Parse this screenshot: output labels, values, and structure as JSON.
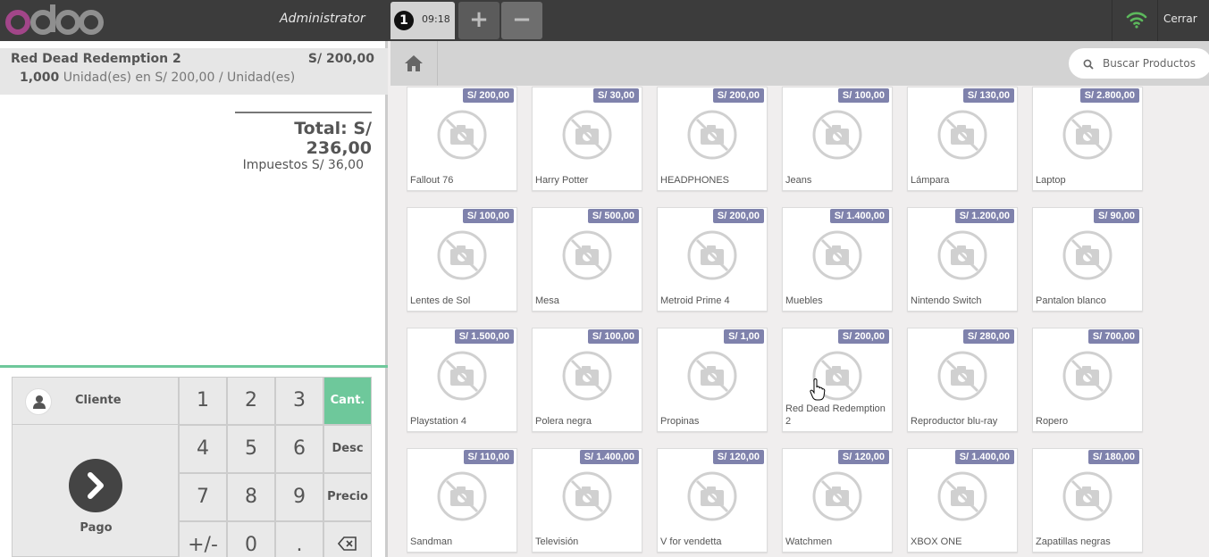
{
  "header": {
    "logo": "odoo",
    "user": "Administrator",
    "order_tab": {
      "number": "1",
      "time": "09:18"
    },
    "add_order": "+",
    "remove_order": "−",
    "close_label": "Cerrar"
  },
  "order": {
    "line": {
      "name": "Red Dead Redemption 2",
      "price": "S/ 200,00",
      "qty": "1,000",
      "detail": "Unidad(es) en S/ 200,00 / Unidad(es)"
    },
    "total": "Total: S/ 236,00",
    "taxes": "Impuestos S/ 36,00"
  },
  "actions": {
    "customer": "Cliente",
    "payment": "Pago"
  },
  "numpad": {
    "keys": [
      "1",
      "2",
      "3",
      "4",
      "5",
      "6",
      "7",
      "8",
      "9",
      "+/-",
      "0",
      "."
    ],
    "modes": [
      "Cant.",
      "Desc",
      "Precio"
    ],
    "active_mode": "Cant."
  },
  "search": {
    "placeholder": "Buscar Productos"
  },
  "colors": {
    "accent": "#6ec89b",
    "price_tag": "#7f82ac",
    "topbar": "#3c3c3c"
  },
  "products": [
    {
      "name": "Fallout 76",
      "price": "S/ 200,00"
    },
    {
      "name": "Harry Potter",
      "price": "S/ 30,00"
    },
    {
      "name": "HEADPHONES",
      "price": "S/ 200,00"
    },
    {
      "name": "Jeans",
      "price": "S/ 100,00"
    },
    {
      "name": "Lámpara",
      "price": "S/ 130,00"
    },
    {
      "name": "Laptop",
      "price": "S/ 2.800,00"
    },
    {
      "name": "Lentes de Sol",
      "price": "S/ 100,00"
    },
    {
      "name": "Mesa",
      "price": "S/ 500,00"
    },
    {
      "name": "Metroid Prime 4",
      "price": "S/ 200,00"
    },
    {
      "name": "Muebles",
      "price": "S/ 1.400,00"
    },
    {
      "name": "Nintendo Switch",
      "price": "S/ 1.200,00"
    },
    {
      "name": "Pantalon blanco",
      "price": "S/ 90,00"
    },
    {
      "name": "Playstation 4",
      "price": "S/ 1.500,00"
    },
    {
      "name": "Polera negra",
      "price": "S/ 100,00"
    },
    {
      "name": "Propinas",
      "price": "S/ 1,00"
    },
    {
      "name": "Red Dead Redemption 2",
      "price": "S/ 200,00"
    },
    {
      "name": "Reproductor blu-ray",
      "price": "S/ 280,00"
    },
    {
      "name": "Ropero",
      "price": "S/ 700,00"
    },
    {
      "name": "Sandman",
      "price": "S/ 110,00"
    },
    {
      "name": "Televisión",
      "price": "S/ 1.400,00"
    },
    {
      "name": "V for vendetta",
      "price": "S/ 120,00"
    },
    {
      "name": "Watchmen",
      "price": "S/ 120,00"
    },
    {
      "name": "XBOX ONE",
      "price": "S/ 1.400,00"
    },
    {
      "name": "Zapatillas negras",
      "price": "S/ 180,00"
    }
  ]
}
